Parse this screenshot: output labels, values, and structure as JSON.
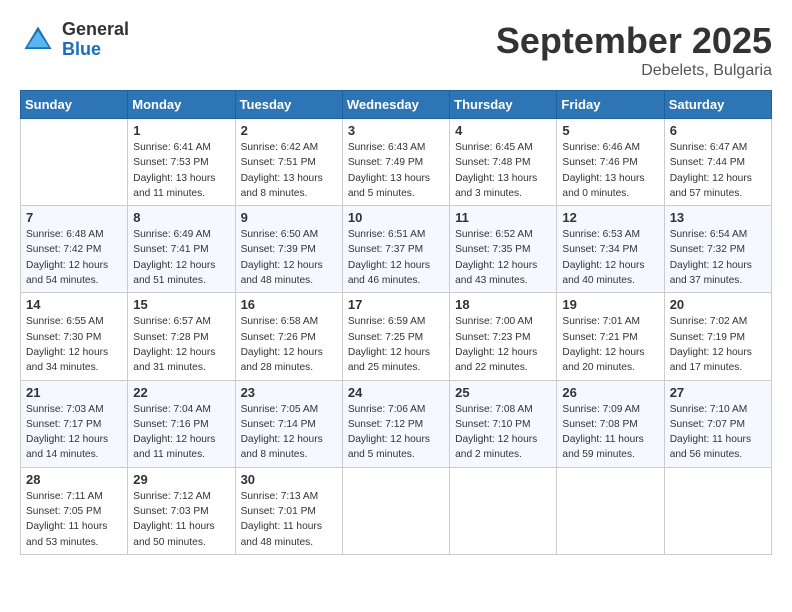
{
  "header": {
    "logo_general": "General",
    "logo_blue": "Blue",
    "month_title": "September 2025",
    "location": "Debelets, Bulgaria"
  },
  "days_of_week": [
    "Sunday",
    "Monday",
    "Tuesday",
    "Wednesday",
    "Thursday",
    "Friday",
    "Saturday"
  ],
  "weeks": [
    [
      {
        "day": "",
        "sunrise": "",
        "sunset": "",
        "daylight": ""
      },
      {
        "day": "1",
        "sunrise": "Sunrise: 6:41 AM",
        "sunset": "Sunset: 7:53 PM",
        "daylight": "Daylight: 13 hours and 11 minutes."
      },
      {
        "day": "2",
        "sunrise": "Sunrise: 6:42 AM",
        "sunset": "Sunset: 7:51 PM",
        "daylight": "Daylight: 13 hours and 8 minutes."
      },
      {
        "day": "3",
        "sunrise": "Sunrise: 6:43 AM",
        "sunset": "Sunset: 7:49 PM",
        "daylight": "Daylight: 13 hours and 5 minutes."
      },
      {
        "day": "4",
        "sunrise": "Sunrise: 6:45 AM",
        "sunset": "Sunset: 7:48 PM",
        "daylight": "Daylight: 13 hours and 3 minutes."
      },
      {
        "day": "5",
        "sunrise": "Sunrise: 6:46 AM",
        "sunset": "Sunset: 7:46 PM",
        "daylight": "Daylight: 13 hours and 0 minutes."
      },
      {
        "day": "6",
        "sunrise": "Sunrise: 6:47 AM",
        "sunset": "Sunset: 7:44 PM",
        "daylight": "Daylight: 12 hours and 57 minutes."
      }
    ],
    [
      {
        "day": "7",
        "sunrise": "Sunrise: 6:48 AM",
        "sunset": "Sunset: 7:42 PM",
        "daylight": "Daylight: 12 hours and 54 minutes."
      },
      {
        "day": "8",
        "sunrise": "Sunrise: 6:49 AM",
        "sunset": "Sunset: 7:41 PM",
        "daylight": "Daylight: 12 hours and 51 minutes."
      },
      {
        "day": "9",
        "sunrise": "Sunrise: 6:50 AM",
        "sunset": "Sunset: 7:39 PM",
        "daylight": "Daylight: 12 hours and 48 minutes."
      },
      {
        "day": "10",
        "sunrise": "Sunrise: 6:51 AM",
        "sunset": "Sunset: 7:37 PM",
        "daylight": "Daylight: 12 hours and 46 minutes."
      },
      {
        "day": "11",
        "sunrise": "Sunrise: 6:52 AM",
        "sunset": "Sunset: 7:35 PM",
        "daylight": "Daylight: 12 hours and 43 minutes."
      },
      {
        "day": "12",
        "sunrise": "Sunrise: 6:53 AM",
        "sunset": "Sunset: 7:34 PM",
        "daylight": "Daylight: 12 hours and 40 minutes."
      },
      {
        "day": "13",
        "sunrise": "Sunrise: 6:54 AM",
        "sunset": "Sunset: 7:32 PM",
        "daylight": "Daylight: 12 hours and 37 minutes."
      }
    ],
    [
      {
        "day": "14",
        "sunrise": "Sunrise: 6:55 AM",
        "sunset": "Sunset: 7:30 PM",
        "daylight": "Daylight: 12 hours and 34 minutes."
      },
      {
        "day": "15",
        "sunrise": "Sunrise: 6:57 AM",
        "sunset": "Sunset: 7:28 PM",
        "daylight": "Daylight: 12 hours and 31 minutes."
      },
      {
        "day": "16",
        "sunrise": "Sunrise: 6:58 AM",
        "sunset": "Sunset: 7:26 PM",
        "daylight": "Daylight: 12 hours and 28 minutes."
      },
      {
        "day": "17",
        "sunrise": "Sunrise: 6:59 AM",
        "sunset": "Sunset: 7:25 PM",
        "daylight": "Daylight: 12 hours and 25 minutes."
      },
      {
        "day": "18",
        "sunrise": "Sunrise: 7:00 AM",
        "sunset": "Sunset: 7:23 PM",
        "daylight": "Daylight: 12 hours and 22 minutes."
      },
      {
        "day": "19",
        "sunrise": "Sunrise: 7:01 AM",
        "sunset": "Sunset: 7:21 PM",
        "daylight": "Daylight: 12 hours and 20 minutes."
      },
      {
        "day": "20",
        "sunrise": "Sunrise: 7:02 AM",
        "sunset": "Sunset: 7:19 PM",
        "daylight": "Daylight: 12 hours and 17 minutes."
      }
    ],
    [
      {
        "day": "21",
        "sunrise": "Sunrise: 7:03 AM",
        "sunset": "Sunset: 7:17 PM",
        "daylight": "Daylight: 12 hours and 14 minutes."
      },
      {
        "day": "22",
        "sunrise": "Sunrise: 7:04 AM",
        "sunset": "Sunset: 7:16 PM",
        "daylight": "Daylight: 12 hours and 11 minutes."
      },
      {
        "day": "23",
        "sunrise": "Sunrise: 7:05 AM",
        "sunset": "Sunset: 7:14 PM",
        "daylight": "Daylight: 12 hours and 8 minutes."
      },
      {
        "day": "24",
        "sunrise": "Sunrise: 7:06 AM",
        "sunset": "Sunset: 7:12 PM",
        "daylight": "Daylight: 12 hours and 5 minutes."
      },
      {
        "day": "25",
        "sunrise": "Sunrise: 7:08 AM",
        "sunset": "Sunset: 7:10 PM",
        "daylight": "Daylight: 12 hours and 2 minutes."
      },
      {
        "day": "26",
        "sunrise": "Sunrise: 7:09 AM",
        "sunset": "Sunset: 7:08 PM",
        "daylight": "Daylight: 11 hours and 59 minutes."
      },
      {
        "day": "27",
        "sunrise": "Sunrise: 7:10 AM",
        "sunset": "Sunset: 7:07 PM",
        "daylight": "Daylight: 11 hours and 56 minutes."
      }
    ],
    [
      {
        "day": "28",
        "sunrise": "Sunrise: 7:11 AM",
        "sunset": "Sunset: 7:05 PM",
        "daylight": "Daylight: 11 hours and 53 minutes."
      },
      {
        "day": "29",
        "sunrise": "Sunrise: 7:12 AM",
        "sunset": "Sunset: 7:03 PM",
        "daylight": "Daylight: 11 hours and 50 minutes."
      },
      {
        "day": "30",
        "sunrise": "Sunrise: 7:13 AM",
        "sunset": "Sunset: 7:01 PM",
        "daylight": "Daylight: 11 hours and 48 minutes."
      },
      {
        "day": "",
        "sunrise": "",
        "sunset": "",
        "daylight": ""
      },
      {
        "day": "",
        "sunrise": "",
        "sunset": "",
        "daylight": ""
      },
      {
        "day": "",
        "sunrise": "",
        "sunset": "",
        "daylight": ""
      },
      {
        "day": "",
        "sunrise": "",
        "sunset": "",
        "daylight": ""
      }
    ]
  ]
}
